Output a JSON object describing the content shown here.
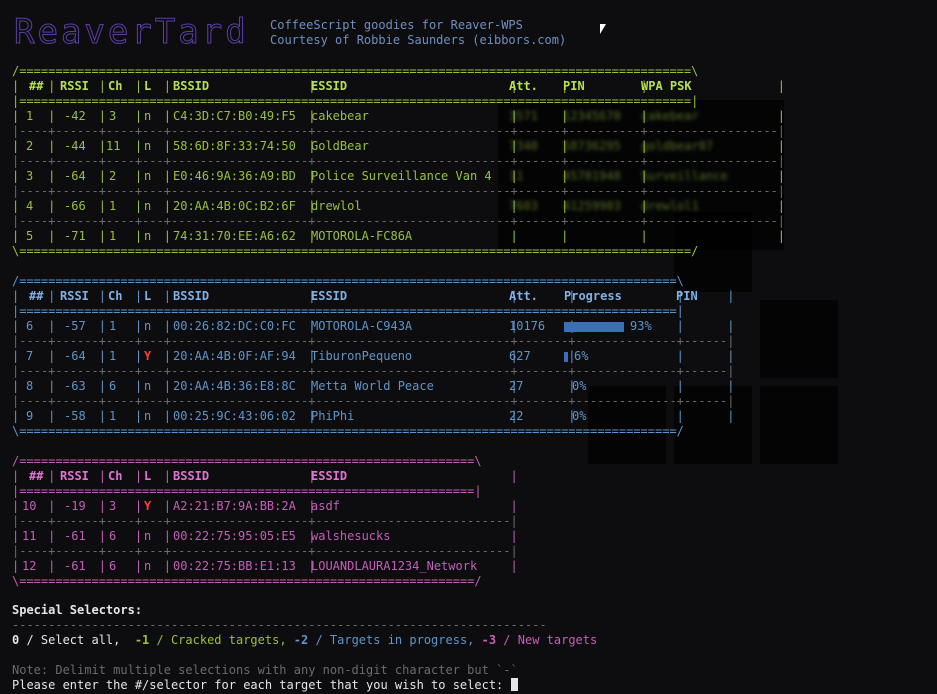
{
  "header": {
    "logo_text": "ReaverTard",
    "tagline1": "CoffeeScript goodies for Reaver-WPS",
    "tagline2": "Courtesy of Robbie Saunders (eibbors.com)"
  },
  "colors": {
    "background": "#0d0d0f",
    "cracked_green": "#97c23d",
    "progress_blue": "#5f95c9",
    "new_pink": "#c45fb8",
    "lock_red": "#ff3b3b",
    "progress_bar": "#3d6fb5"
  },
  "cracked_table": {
    "headers": {
      "num": "##",
      "rssi": "RSSI",
      "ch": "Ch",
      "l": "L",
      "bssid": "BSSID",
      "essid": "ESSID",
      "att": "Att.",
      "pin": "PIN",
      "psk": "WPA PSK"
    },
    "rows": [
      {
        "num": "1",
        "rssi": "-42",
        "ch": "3",
        "l": "n",
        "bssid": "C4:3D:C7:B0:49:F5",
        "essid": "cakebear",
        "att": "3571",
        "pin": "12345670",
        "psk": "cakebear"
      },
      {
        "num": "2",
        "rssi": "-44",
        "ch": "11",
        "l": "n",
        "bssid": "58:6D:8F:33:74:50",
        "essid": "GoldBear",
        "att": "7340",
        "pin": "58736295",
        "psk": "goldbear07"
      },
      {
        "num": "3",
        "rssi": "-64",
        "ch": "2",
        "l": "n",
        "bssid": "E0:46:9A:36:A9:BD",
        "essid": "Police Surveillance Van 4",
        "att": "11",
        "pin": "45781948",
        "psk": "Surveillance"
      },
      {
        "num": "4",
        "rssi": "-66",
        "ch": "1",
        "l": "n",
        "bssid": "20:AA:4B:0C:B2:6F",
        "essid": "drewlol",
        "att": "7603",
        "pin": "41259903",
        "psk": "drewlol1"
      },
      {
        "num": "5",
        "rssi": "-71",
        "ch": "1",
        "l": "n",
        "bssid": "74:31:70:EE:A6:62",
        "essid": "MOTOROLA-FC86A",
        "att": "",
        "pin": "",
        "psk": ""
      }
    ]
  },
  "progress_table": {
    "headers": {
      "num": "##",
      "rssi": "RSSI",
      "ch": "Ch",
      "l": "L",
      "bssid": "BSSID",
      "essid": "ESSID",
      "att": "Att.",
      "progress": "Progress",
      "pin": "PIN"
    },
    "rows": [
      {
        "num": "6",
        "rssi": "-57",
        "ch": "1",
        "l": "n",
        "bssid": "00:26:82:DC:C0:FC",
        "essid": "MOTOROLA-C943A",
        "att": "10176",
        "progress_label": "93%",
        "progress": 0.93,
        "pin": ""
      },
      {
        "num": "7",
        "rssi": "-64",
        "ch": "1",
        "l": "Y",
        "bssid": "20:AA:4B:0F:AF:94",
        "essid": "TiburonPequeno",
        "att": "627",
        "progress_label": "6%",
        "progress": 0.06,
        "pin": ""
      },
      {
        "num": "8",
        "rssi": "-63",
        "ch": "6",
        "l": "n",
        "bssid": "20:AA:4B:36:E8:8C",
        "essid": "Metta World Peace",
        "att": "27",
        "progress_label": "0%",
        "progress": 0,
        "pin": ""
      },
      {
        "num": "9",
        "rssi": "-58",
        "ch": "1",
        "l": "n",
        "bssid": "00:25:9C:43:06:02",
        "essid": "PhiPhi",
        "att": "22",
        "progress_label": "0%",
        "progress": 0,
        "pin": ""
      }
    ]
  },
  "new_table": {
    "headers": {
      "num": "##",
      "rssi": "RSSI",
      "ch": "Ch",
      "l": "L",
      "bssid": "BSSID",
      "essid": "ESSID"
    },
    "rows": [
      {
        "num": "10",
        "rssi": "-19",
        "ch": "3",
        "l": "Y",
        "bssid": "A2:21:B7:9A:BB:2A",
        "essid": "asdf"
      },
      {
        "num": "11",
        "rssi": "-61",
        "ch": "6",
        "l": "n",
        "bssid": "00:22:75:95:05:E5",
        "essid": "walshesucks"
      },
      {
        "num": "12",
        "rssi": "-61",
        "ch": "6",
        "l": "n",
        "bssid": "00:22:75:BB:E1:13",
        "essid": "LOUANDLAURA1234_Network"
      }
    ]
  },
  "selectors": {
    "title": "Special Selectors:",
    "rule": "--------------------------------------------------------------------------",
    "s0_num": "0",
    "s0_label": " / Select all,  ",
    "s1_num": "-1",
    "s1_label": " / Cracked targets, ",
    "s2_num": "-2",
    "s2_label": " / Targets in progress, ",
    "s3_num": "-3",
    "s3_label": " / New targets"
  },
  "footer": {
    "note": "Note: Delimit multiple selections with any non-digit character but `-`",
    "prompt": "Please enter the #/selector for each target that you wish to select: "
  }
}
